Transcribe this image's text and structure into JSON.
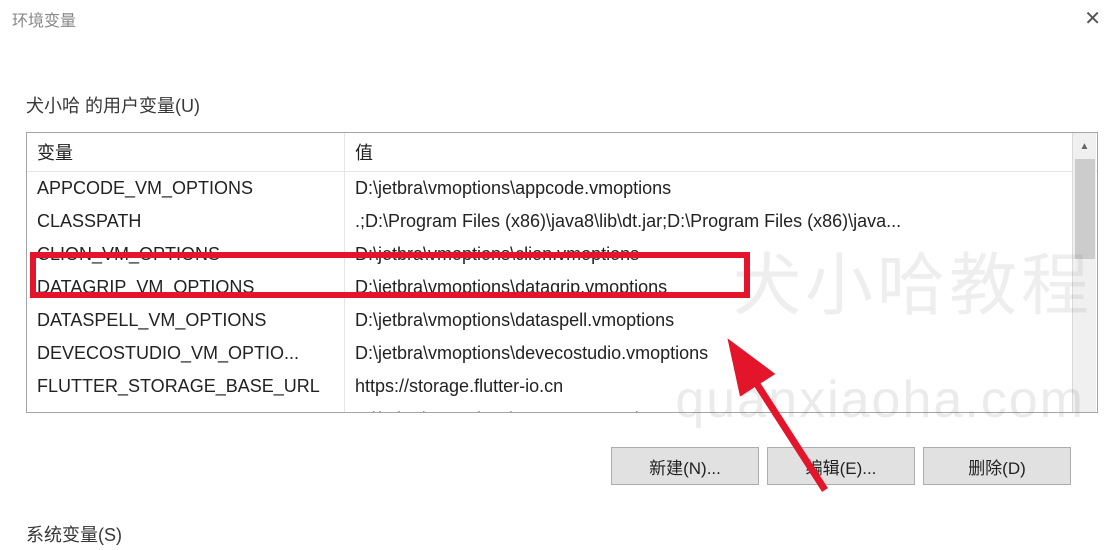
{
  "window": {
    "title": "环境变量"
  },
  "section_user": {
    "label": "犬小哈 的用户变量(U)"
  },
  "headers": {
    "variable": "变量",
    "value": "值"
  },
  "rows": [
    {
      "variable": "APPCODE_VM_OPTIONS",
      "value": "D:\\jetbra\\vmoptions\\appcode.vmoptions"
    },
    {
      "variable": "CLASSPATH",
      "value": ".;D:\\Program Files (x86)\\java8\\lib\\dt.jar;D:\\Program Files (x86)\\java..."
    },
    {
      "variable": "CLION_VM_OPTIONS",
      "value": "D:\\jetbra\\vmoptions\\clion.vmoptions"
    },
    {
      "variable": "DATAGRIP_VM_OPTIONS",
      "value": "D:\\jetbra\\vmoptions\\datagrip.vmoptions"
    },
    {
      "variable": "DATASPELL_VM_OPTIONS",
      "value": "D:\\jetbra\\vmoptions\\dataspell.vmoptions"
    },
    {
      "variable": "DEVECOSTUDIO_VM_OPTIO...",
      "value": "D:\\jetbra\\vmoptions\\devecostudio.vmoptions"
    },
    {
      "variable": "FLUTTER_STORAGE_BASE_URL",
      "value": "https://storage.flutter-io.cn"
    },
    {
      "variable": "GATEWAY_VM_OPTIONS",
      "value": "D:\\jetbra\\vmoptions\\gateway.vmoptions"
    }
  ],
  "buttons": {
    "new": "新建(N)...",
    "edit": "编辑(E)...",
    "delete": "删除(D)"
  },
  "section_system": {
    "label": "系统变量(S)"
  },
  "watermark": {
    "text": "quanxiaoha.com",
    "cn": "犬小哈教程"
  }
}
